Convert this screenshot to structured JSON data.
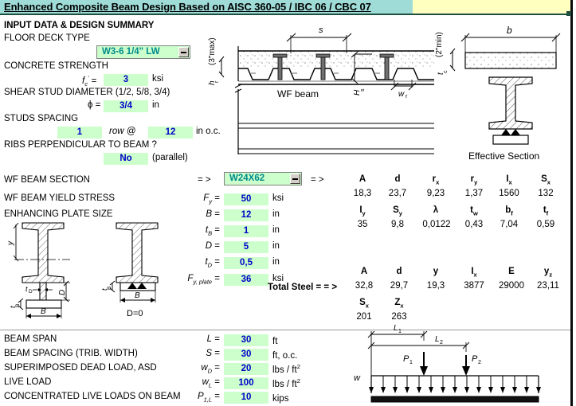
{
  "header": {
    "title": "Enhanced Composite Beam Design Based on AISC 360-05 / IBC 06 / CBC 07"
  },
  "section_title": "INPUT DATA & DESIGN SUMMARY",
  "inputs": {
    "deck_type": {
      "label": "FLOOR DECK TYPE",
      "value": "W3-6 1/4\" LW"
    },
    "concrete_strength": {
      "label": "CONCRETE STRENGTH",
      "symbol": "f",
      "sub": "c",
      "prime": "'",
      "eq": "=",
      "value": "3",
      "unit": "ksi"
    },
    "stud_diameter": {
      "label": "SHEAR STUD DIAMETER (1/2, 5/8, 3/4)",
      "symbol": "ϕ",
      "eq": "=",
      "value": "3/4",
      "unit": "in"
    },
    "studs_spacing": {
      "label": "STUDS SPACING",
      "rows_value": "1",
      "mid": "row @",
      "spacing_value": "12",
      "unit": "in o.c."
    },
    "ribs": {
      "label": "RIBS PERPENDICULAR TO BEAM ?",
      "value": "No",
      "note": "(parallel)"
    }
  },
  "beam": {
    "section": {
      "label": "WF BEAM SECTION",
      "arrow": "= >",
      "value": "W24X62",
      "arrow2": "= >"
    },
    "yield_stress": {
      "label": "WF BEAM YIELD STRESS",
      "symbol": "F",
      "sub": "y",
      "eq": "=",
      "value": "50",
      "unit": "ksi"
    },
    "plate_size": {
      "label": "ENHANCING PLATE SIZE"
    },
    "B": {
      "symbol": "B",
      "eq": "=",
      "value": "12",
      "unit": "in"
    },
    "tB": {
      "symbol": "t",
      "sub": "B",
      "eq": "=",
      "value": "1",
      "unit": "in"
    },
    "D": {
      "symbol": "D",
      "eq": "=",
      "value": "5",
      "unit": "in"
    },
    "tD": {
      "symbol": "t",
      "sub": "D",
      "eq": "=",
      "value": "0,5",
      "unit": "in"
    },
    "fy_plate": {
      "symbol": "F",
      "sub": "y, plate",
      "eq": "=",
      "value": "36",
      "unit": "ksi"
    }
  },
  "props_table": {
    "row1_headers": [
      "A",
      "d",
      "r",
      "r",
      "I",
      "S"
    ],
    "row1_subs": [
      "",
      "",
      "x",
      "y",
      "x",
      "x"
    ],
    "row1_values": [
      "18,3",
      "23,7",
      "9,23",
      "1,37",
      "1560",
      "132"
    ],
    "row2_headers": [
      "I",
      "S",
      "λ",
      "t",
      "b",
      "t"
    ],
    "row2_subs": [
      "y",
      "y",
      "",
      "w",
      "f",
      "f"
    ],
    "row2_values": [
      "35",
      "9,8",
      "0,0122",
      "0,43",
      "7,04",
      "0,59"
    ]
  },
  "total_steel": {
    "label": "Total Steel = = >",
    "row1_headers": [
      "A",
      "d",
      "y",
      "I",
      "E",
      "y"
    ],
    "row1_subs": [
      "",
      "",
      "",
      "x",
      "",
      "z"
    ],
    "row1_values": [
      "32,8",
      "29,7",
      "19,3",
      "3877",
      "29000",
      "23,11"
    ],
    "row2_headers": [
      "S",
      "Z"
    ],
    "row2_subs": [
      "x",
      "x"
    ],
    "row2_values": [
      "201",
      "263"
    ]
  },
  "loads": [
    {
      "label": "BEAM SPAN",
      "symbol": "L",
      "sub": "",
      "eq": "=",
      "value": "30",
      "unit": "ft",
      "unit_sup": ""
    },
    {
      "label": "BEAM SPACING (TRIB. WIDTH)",
      "symbol": "S",
      "sub": "",
      "eq": "=",
      "value": "30",
      "unit": "ft, o.c.",
      "unit_sup": ""
    },
    {
      "label": "SUPERIMPOSED DEAD LOAD, ASD",
      "symbol": "w",
      "sub": "D",
      "eq": "=",
      "value": "20",
      "unit": "lbs / ft",
      "unit_sup": "2"
    },
    {
      "label": "LIVE LOAD",
      "symbol": "w",
      "sub": "L",
      "eq": "=",
      "value": "100",
      "unit": "lbs / ft",
      "unit_sup": "2"
    },
    {
      "label": "CONCENTRATED LIVE LOADS ON BEAM",
      "symbol": "P",
      "sub": "1,L",
      "eq": "=",
      "value": "10",
      "unit": "kips",
      "unit_sup": ""
    }
  ],
  "diagrams": {
    "deck": {
      "span_label": "s",
      "hr_label": "h",
      "hr_sub": "r",
      "hr_note": "(3\"max)",
      "beam_label": "WF  beam",
      "stud_height_label": "H",
      "stud_height_sub": "s",
      "rib_width_label": "w",
      "rib_width_sub": "r"
    },
    "effective": {
      "b_label": "b",
      "tc_label": "t",
      "tc_sub": "c",
      "tc_note": "(2\"min)",
      "caption": "Effective  Section"
    },
    "plate_left": {
      "y_label": "y",
      "tD_label": "t",
      "tD_sub": "D",
      "tB_label": "t",
      "tB_sub": "B",
      "B_label": "B",
      "D_label": "D"
    },
    "plate_right": {
      "tB_label": "t",
      "tB_sub": "B",
      "B_label": "B",
      "note": "D=0"
    },
    "load": {
      "L1": "L",
      "L1_sub": "1",
      "L2": "L",
      "L2_sub": "2",
      "P1": "P",
      "P1_sub": "1",
      "P2": "P",
      "P2_sub": "2",
      "w": "w"
    }
  },
  "colors": {
    "title_bg": "#9fdcd8",
    "input_bg": "#ccffcc",
    "value_text": "#0000c8",
    "combo_text": "#008b8b",
    "yellow": "#ffffc0"
  }
}
